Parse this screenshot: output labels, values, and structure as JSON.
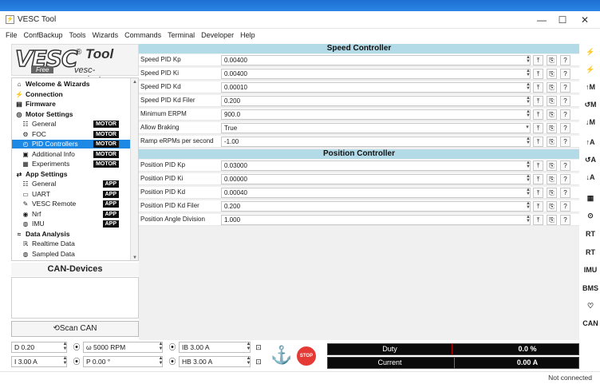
{
  "window": {
    "title": "VESC Tool",
    "min": "—",
    "max": "☐",
    "close": "✕"
  },
  "menu": [
    "File",
    "ConfBackup",
    "Tools",
    "Wizards",
    "Commands",
    "Terminal",
    "Developer",
    "Help"
  ],
  "logo": {
    "main": "VESC",
    "tool": "Tool",
    "free": "Free",
    "site": "vesc-project.com",
    "reg": "®"
  },
  "tree": [
    {
      "label": "Welcome & Wizards",
      "kind": "cat",
      "icon": "⌂",
      "iconname": "home-icon"
    },
    {
      "label": "Connection",
      "kind": "cat",
      "icon": "⚡",
      "iconname": "plug-icon"
    },
    {
      "label": "Firmware",
      "kind": "cat",
      "icon": "▤",
      "iconname": "chip-icon"
    },
    {
      "label": "Motor Settings",
      "kind": "cat",
      "icon": "◎",
      "iconname": "motor-icon"
    },
    {
      "label": "General",
      "kind": "item",
      "icon": "☷",
      "iconname": "sliders-icon",
      "badge": "MOTOR"
    },
    {
      "label": "FOC",
      "kind": "item",
      "icon": "⚙",
      "iconname": "foc-icon",
      "badge": "MOTOR"
    },
    {
      "label": "PID Controllers",
      "kind": "item",
      "icon": "◴",
      "iconname": "gauge-icon",
      "badge": "MOTOR",
      "selected": true
    },
    {
      "label": "Additional Info",
      "kind": "item",
      "icon": "▣",
      "iconname": "info-icon",
      "badge": "MOTOR"
    },
    {
      "label": "Experiments",
      "kind": "item",
      "icon": "▦",
      "iconname": "experiment-icon",
      "badge": "MOTOR"
    },
    {
      "label": "App Settings",
      "kind": "cat",
      "icon": "⇄",
      "iconname": "app-icon"
    },
    {
      "label": "General",
      "kind": "item",
      "icon": "☷",
      "iconname": "sliders-icon",
      "badge": "APP"
    },
    {
      "label": "UART",
      "kind": "item",
      "icon": "▭",
      "iconname": "uart-icon",
      "badge": "APP"
    },
    {
      "label": "VESC Remote",
      "kind": "item",
      "icon": "✎",
      "iconname": "remote-icon",
      "badge": "APP"
    },
    {
      "label": "Nrf",
      "kind": "item",
      "icon": "◉",
      "iconname": "wireless-icon",
      "badge": "APP"
    },
    {
      "label": "IMU",
      "kind": "item",
      "icon": "◍",
      "iconname": "imu-icon",
      "badge": "APP"
    },
    {
      "label": "Data Analysis",
      "kind": "cat",
      "icon": "≈",
      "iconname": "chart-icon"
    },
    {
      "label": "Realtime Data",
      "kind": "item",
      "icon": "ℝ",
      "iconname": "realtime-icon"
    },
    {
      "label": "Sampled Data",
      "kind": "item",
      "icon": "◍",
      "iconname": "sampled-icon"
    }
  ],
  "can": {
    "header": "CAN-Devices",
    "scan": "⟲Scan CAN"
  },
  "speed": {
    "title": "Speed Controller",
    "rows": [
      {
        "label": "Speed PID Kp",
        "value": "0.00400",
        "type": "spin"
      },
      {
        "label": "Speed PID Ki",
        "value": "0.00400",
        "type": "spin"
      },
      {
        "label": "Speed PID Kd",
        "value": "0.00010",
        "type": "spin"
      },
      {
        "label": "Speed PID Kd Filer",
        "value": "0.200",
        "type": "spin"
      },
      {
        "label": "Minimum ERPM",
        "value": "900.0",
        "type": "spin"
      },
      {
        "label": "Allow Braking",
        "value": "True",
        "type": "dropdown"
      },
      {
        "label": "Ramp eRPMs per second",
        "value": "-1.00",
        "type": "spin"
      }
    ]
  },
  "position": {
    "title": "Position Controller",
    "rows": [
      {
        "label": "Position PID Kp",
        "value": "0.03000",
        "type": "spin"
      },
      {
        "label": "Position PID Ki",
        "value": "0.00000",
        "type": "spin"
      },
      {
        "label": "Position PID Kd",
        "value": "0.00040",
        "type": "spin"
      },
      {
        "label": "Position PID Kd Filer",
        "value": "0.200",
        "type": "spin"
      },
      {
        "label": "Position Angle Division",
        "value": "1.000",
        "type": "spin"
      }
    ]
  },
  "rowbuttons": {
    "upload": "⤒",
    "copy": "⎘",
    "help": "?"
  },
  "rightbar": [
    "⚡",
    "⚡",
    "↑M",
    "↺M",
    "↓M",
    "↑A",
    "↺A",
    "↓A",
    "▦",
    "⊙",
    "RT",
    "RT",
    "IMU",
    "BMS",
    "♡",
    "CAN"
  ],
  "rightbar_names": [
    "connect-icon",
    "disconnect-icon",
    "read-motor-config-icon",
    "reset-motor-config-icon",
    "write-motor-config-icon",
    "read-app-config-icon",
    "reset-app-config-icon",
    "write-app-config-icon",
    "keyboard-control-icon",
    "gamepad-icon",
    "rt-data-icon",
    "rt-app-data-icon",
    "imu-data-icon",
    "bms-data-icon",
    "heart-icon",
    "can-fwd-icon"
  ],
  "bottom": {
    "duty_ctl": "D 0.20",
    "rpm_ctl": "ω 5000 RPM",
    "ib_ctl": "IB 3.00 A",
    "current_ctl": "I 3.00 A",
    "pos_ctl": "P 0.00 °",
    "hb_ctl": "HB 3.00 A",
    "stop": "STOP",
    "duty_label": "Duty",
    "duty_value": "0.0 %",
    "current_label": "Current",
    "current_value": "0.00 A"
  },
  "status": "Not connected"
}
